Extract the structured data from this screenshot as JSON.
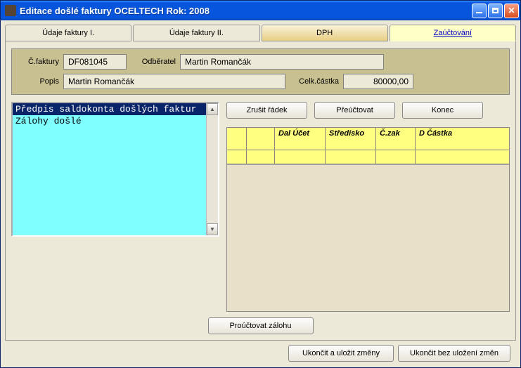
{
  "window": {
    "title": "Editace došlé faktury  OCELTECH  Rok: 2008"
  },
  "tabs": [
    {
      "label": "Údaje faktury I."
    },
    {
      "label": "Údaje faktury II."
    },
    {
      "label": "DPH"
    },
    {
      "label": "Zaúčtování"
    }
  ],
  "info": {
    "invoice_no_label": "Č.faktury",
    "invoice_no": "DF081045",
    "customer_label": "Odběratel",
    "customer": "Martin Romančák",
    "desc_label": "Popis",
    "desc": "Martin Romančák",
    "total_label": "Celk.částka",
    "total": "80000,00"
  },
  "listbox": {
    "items": [
      {
        "text": "Předpis saldokonta došlých faktur",
        "selected": true
      },
      {
        "text": "Zálohy došlé",
        "selected": false
      }
    ]
  },
  "buttons": {
    "cancel_row": "Zrušit řádek",
    "recalc": "Přeúčtovat",
    "end": "Konec",
    "process_advance": "Proúčtovat zálohu",
    "save_close": "Ukončit a uložit změny",
    "close_nosave": "Ukončit bez uložení změn"
  },
  "grid": {
    "headers": [
      {
        "label": "",
        "w": 28
      },
      {
        "label": "",
        "w": 40
      },
      {
        "label": "Dal Účet",
        "w": 72
      },
      {
        "label": "Středisko",
        "w": 72
      },
      {
        "label": "Č.zak",
        "w": 56
      },
      {
        "label": "D Částka",
        "w": 100
      }
    ]
  }
}
